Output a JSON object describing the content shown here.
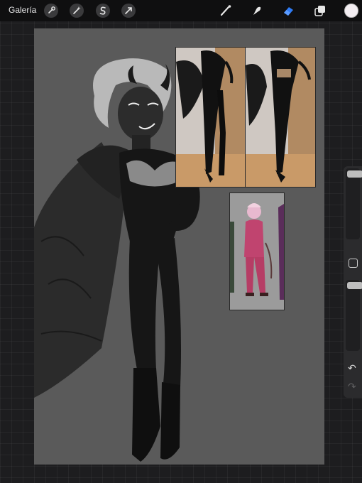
{
  "topbar": {
    "gallery_label": "Galería",
    "tools_left": [
      "wrench-icon",
      "magic-wand-icon",
      "selection-s-icon",
      "arrow-transform-icon"
    ],
    "tools_right": [
      "brush-icon",
      "smudge-icon",
      "eraser-icon",
      "layers-icon"
    ],
    "active_tool": "eraser-icon",
    "active_color": "#f3eef2"
  },
  "sidebar": {
    "brush_size_level": 1.0,
    "opacity_level": 1.0,
    "undo_glyph": "↶",
    "redo_glyph": "↷"
  },
  "canvas": {
    "background": "#5a5a5a",
    "references": [
      "photo-reference-left",
      "photo-reference-right",
      "character-reference-pink"
    ]
  }
}
